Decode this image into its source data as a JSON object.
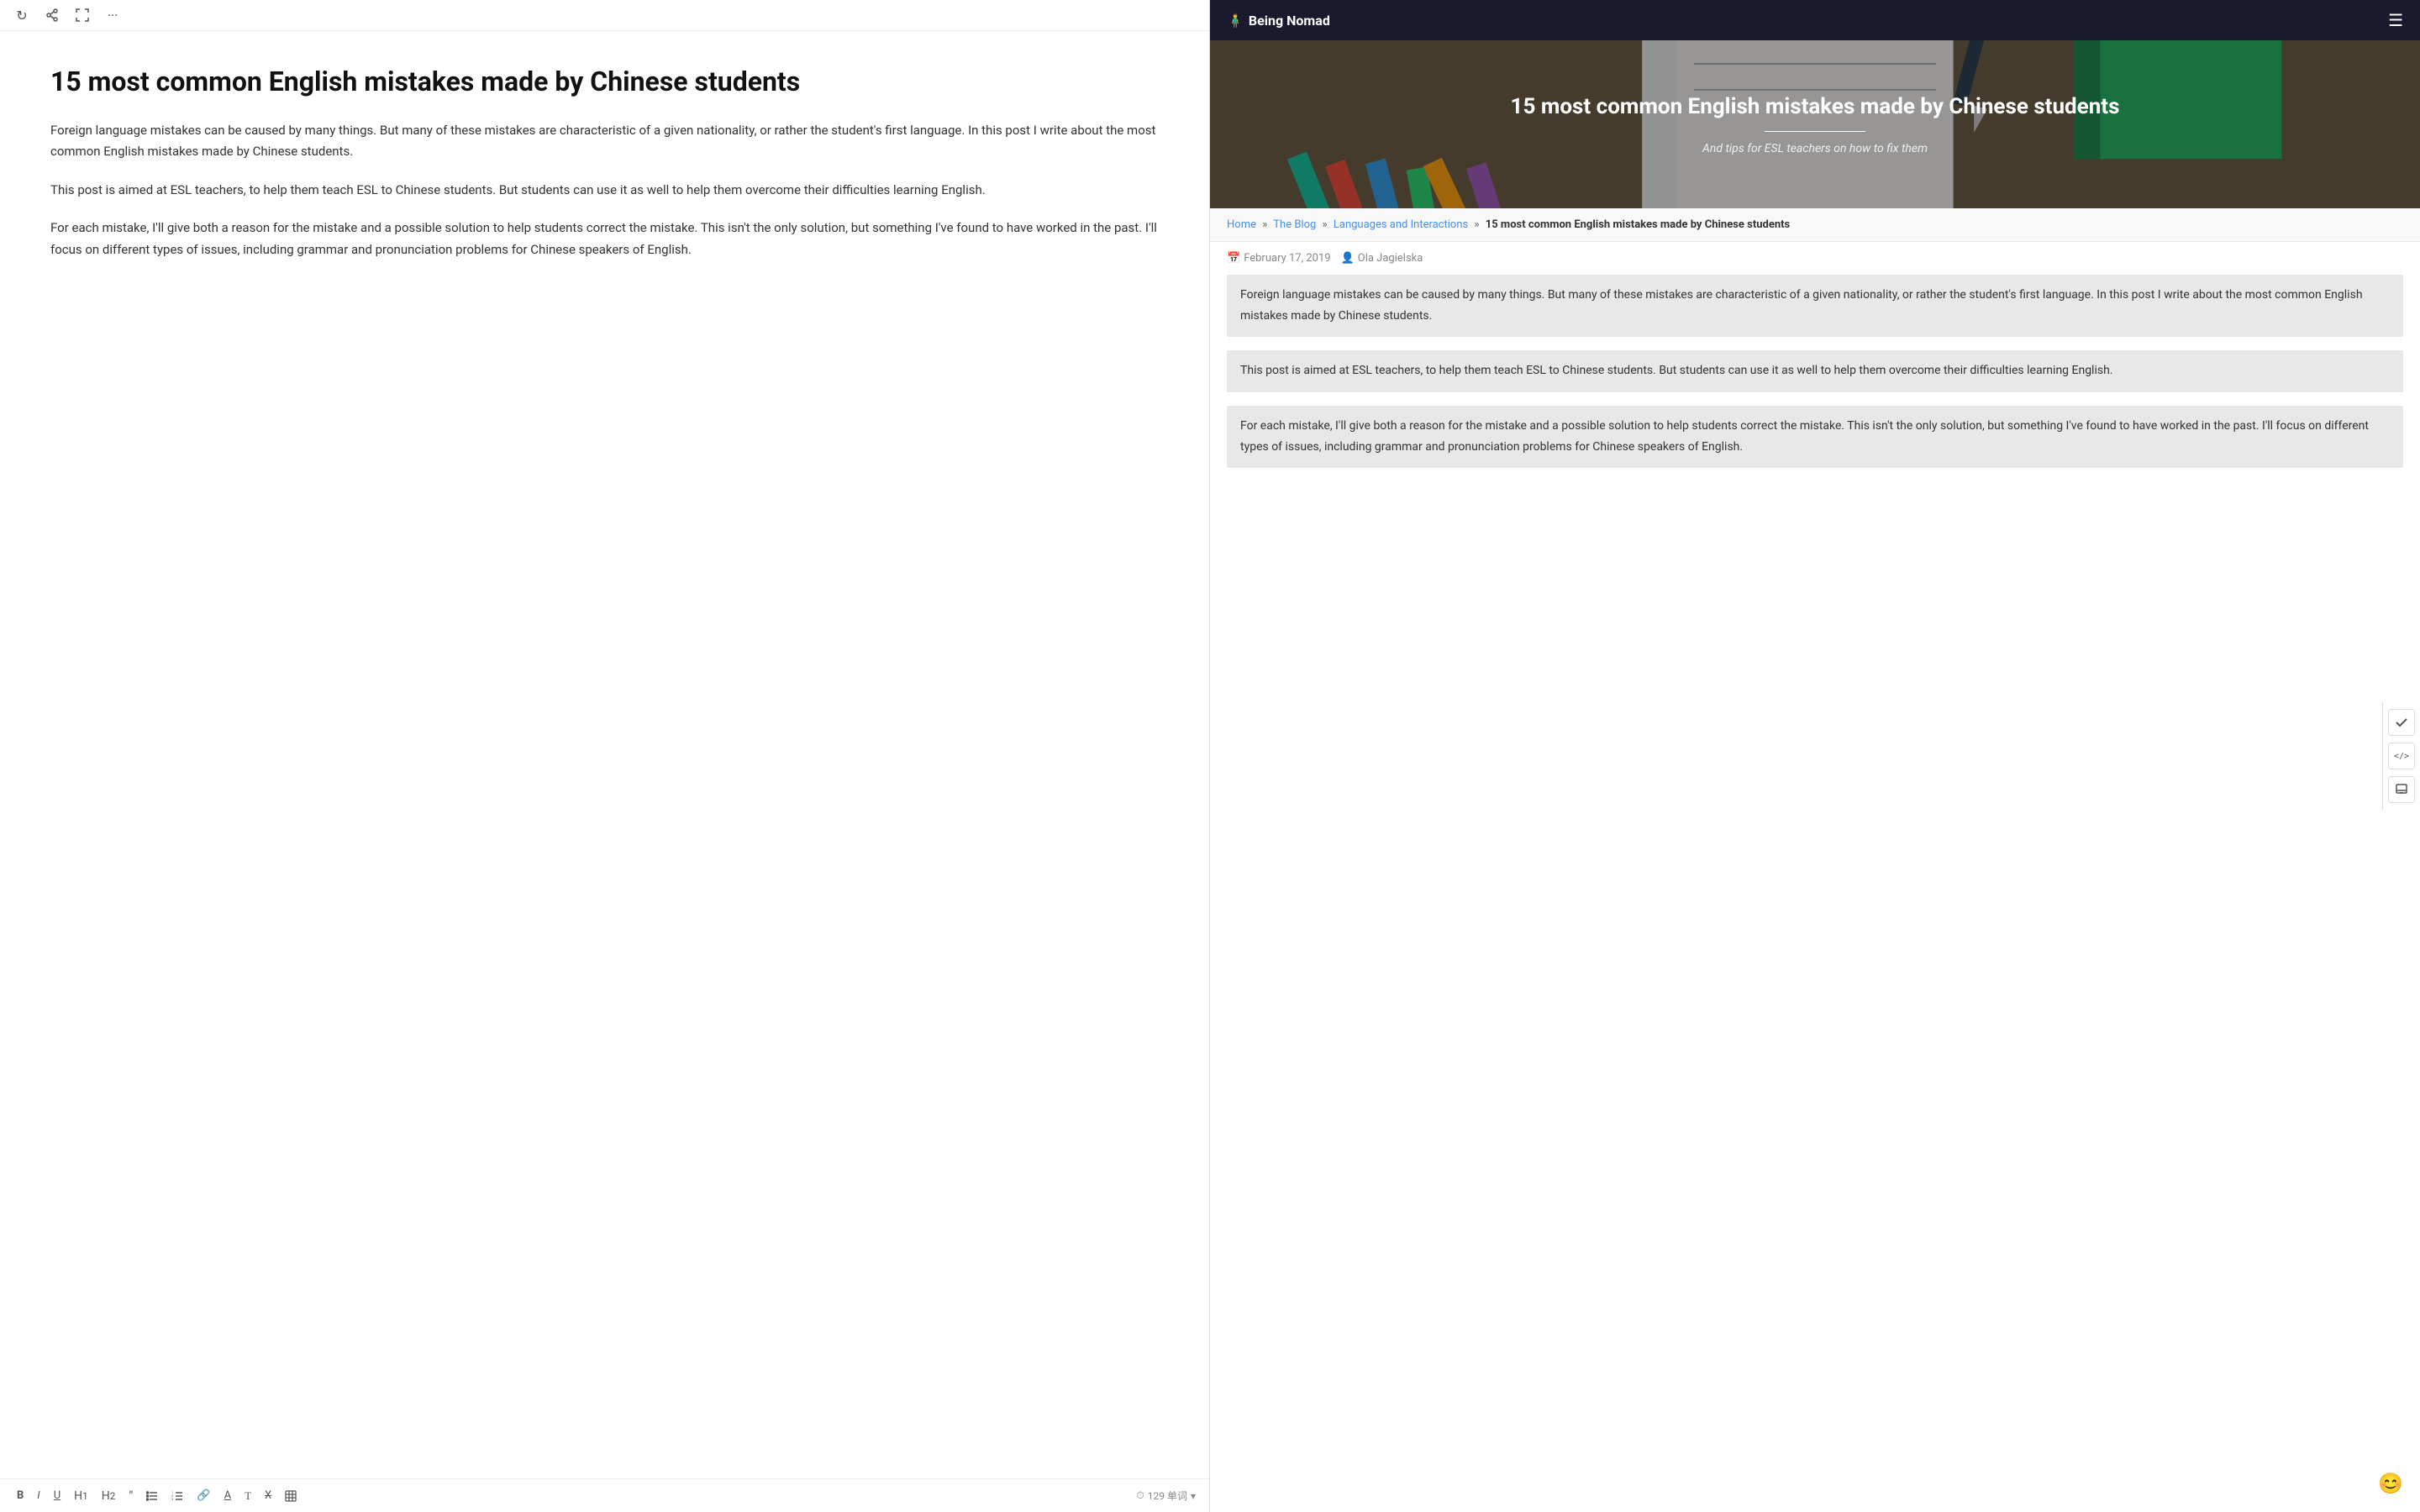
{
  "toolbar_top": {
    "icons": [
      {
        "name": "refresh-icon",
        "symbol": "↻"
      },
      {
        "name": "share-icon",
        "symbol": "↗"
      },
      {
        "name": "expand-icon",
        "symbol": "⤢"
      },
      {
        "name": "more-icon",
        "symbol": "···"
      }
    ]
  },
  "editor": {
    "title": "15 most common English mistakes made by Chinese students",
    "paragraphs": [
      "Foreign language mistakes can be caused by many things. But many of these mistakes are characteristic of a given nationality, or rather the student's first language. In this post I write about the most common English mistakes made by Chinese students.",
      "This post is aimed at ESL teachers, to help them teach ESL to Chinese students. But students can use it as well to help them overcome their difficulties learning English.",
      "For each mistake, I'll give both a reason for the mistake and a possible solution to help students correct the mistake. This isn't the only solution, but something I've found to have worked in the past. I'll focus on different types of issues, including grammar and pronunciation problems for Chinese speakers of English."
    ]
  },
  "bottom_toolbar": {
    "tools": [
      {
        "label": "B",
        "name": "bold-button",
        "style": "bold"
      },
      {
        "label": "I",
        "name": "italic-button",
        "style": "italic"
      },
      {
        "label": "U",
        "name": "underline-button",
        "style": "underline"
      },
      {
        "label": "H¹",
        "name": "h1-button"
      },
      {
        "label": "H²",
        "name": "h2-button"
      },
      {
        "label": "❝",
        "name": "quote-button"
      },
      {
        "label": "≡",
        "name": "list-button"
      },
      {
        "label": "≣",
        "name": "ordered-list-button"
      },
      {
        "label": "🔗",
        "name": "link-button"
      },
      {
        "label": "A̲",
        "name": "underline-text-button"
      },
      {
        "label": "T",
        "name": "text-button"
      },
      {
        "label": "⌫",
        "name": "strikethrough-button"
      },
      {
        "label": "▦",
        "name": "table-button"
      }
    ],
    "word_count_icon": "⏱",
    "word_count": "129 单词",
    "word_count_chevron": "▾"
  },
  "site": {
    "logo": "Being Nomad",
    "logo_icon": "👥",
    "nav_menu_icon": "☰"
  },
  "hero": {
    "title": "15 most common English mistakes made by Chinese students",
    "subtitle": "And tips for ESL teachers on how to fix them"
  },
  "breadcrumb": {
    "home": "Home",
    "separator1": "»",
    "blog": "The Blog",
    "separator2": "»",
    "category": "Languages and Interactions",
    "separator3": "»",
    "current": "15 most common English mistakes made by Chinese students"
  },
  "post_meta": {
    "date_icon": "📅",
    "date": "February 17, 2019",
    "author_icon": "👤",
    "author": "Ola Jagielska"
  },
  "post_body": {
    "paragraphs": [
      "Foreign language mistakes can be caused by many things. But many of these mistakes are characteristic of a given nationality, or rather the student's first language. In this post I write about the most common English mistakes made by Chinese students.",
      "This post is aimed at ESL teachers, to help them teach ESL to Chinese students. But students can use it as well to help them overcome their difficulties learning English.",
      "For each mistake, I'll give both a reason for the mistake and a possible solution to help students correct the mistake. This isn't the only solution, but something I've found to have worked in the past. I'll focus on different types of issues, including grammar and pronunciation problems for Chinese speakers of English."
    ]
  },
  "side_icons": [
    {
      "name": "check-icon",
      "symbol": "✓"
    },
    {
      "name": "code-icon",
      "symbol": "</>"
    },
    {
      "name": "tray-icon",
      "symbol": "⬛"
    }
  ],
  "bottom_emoji": "😊"
}
